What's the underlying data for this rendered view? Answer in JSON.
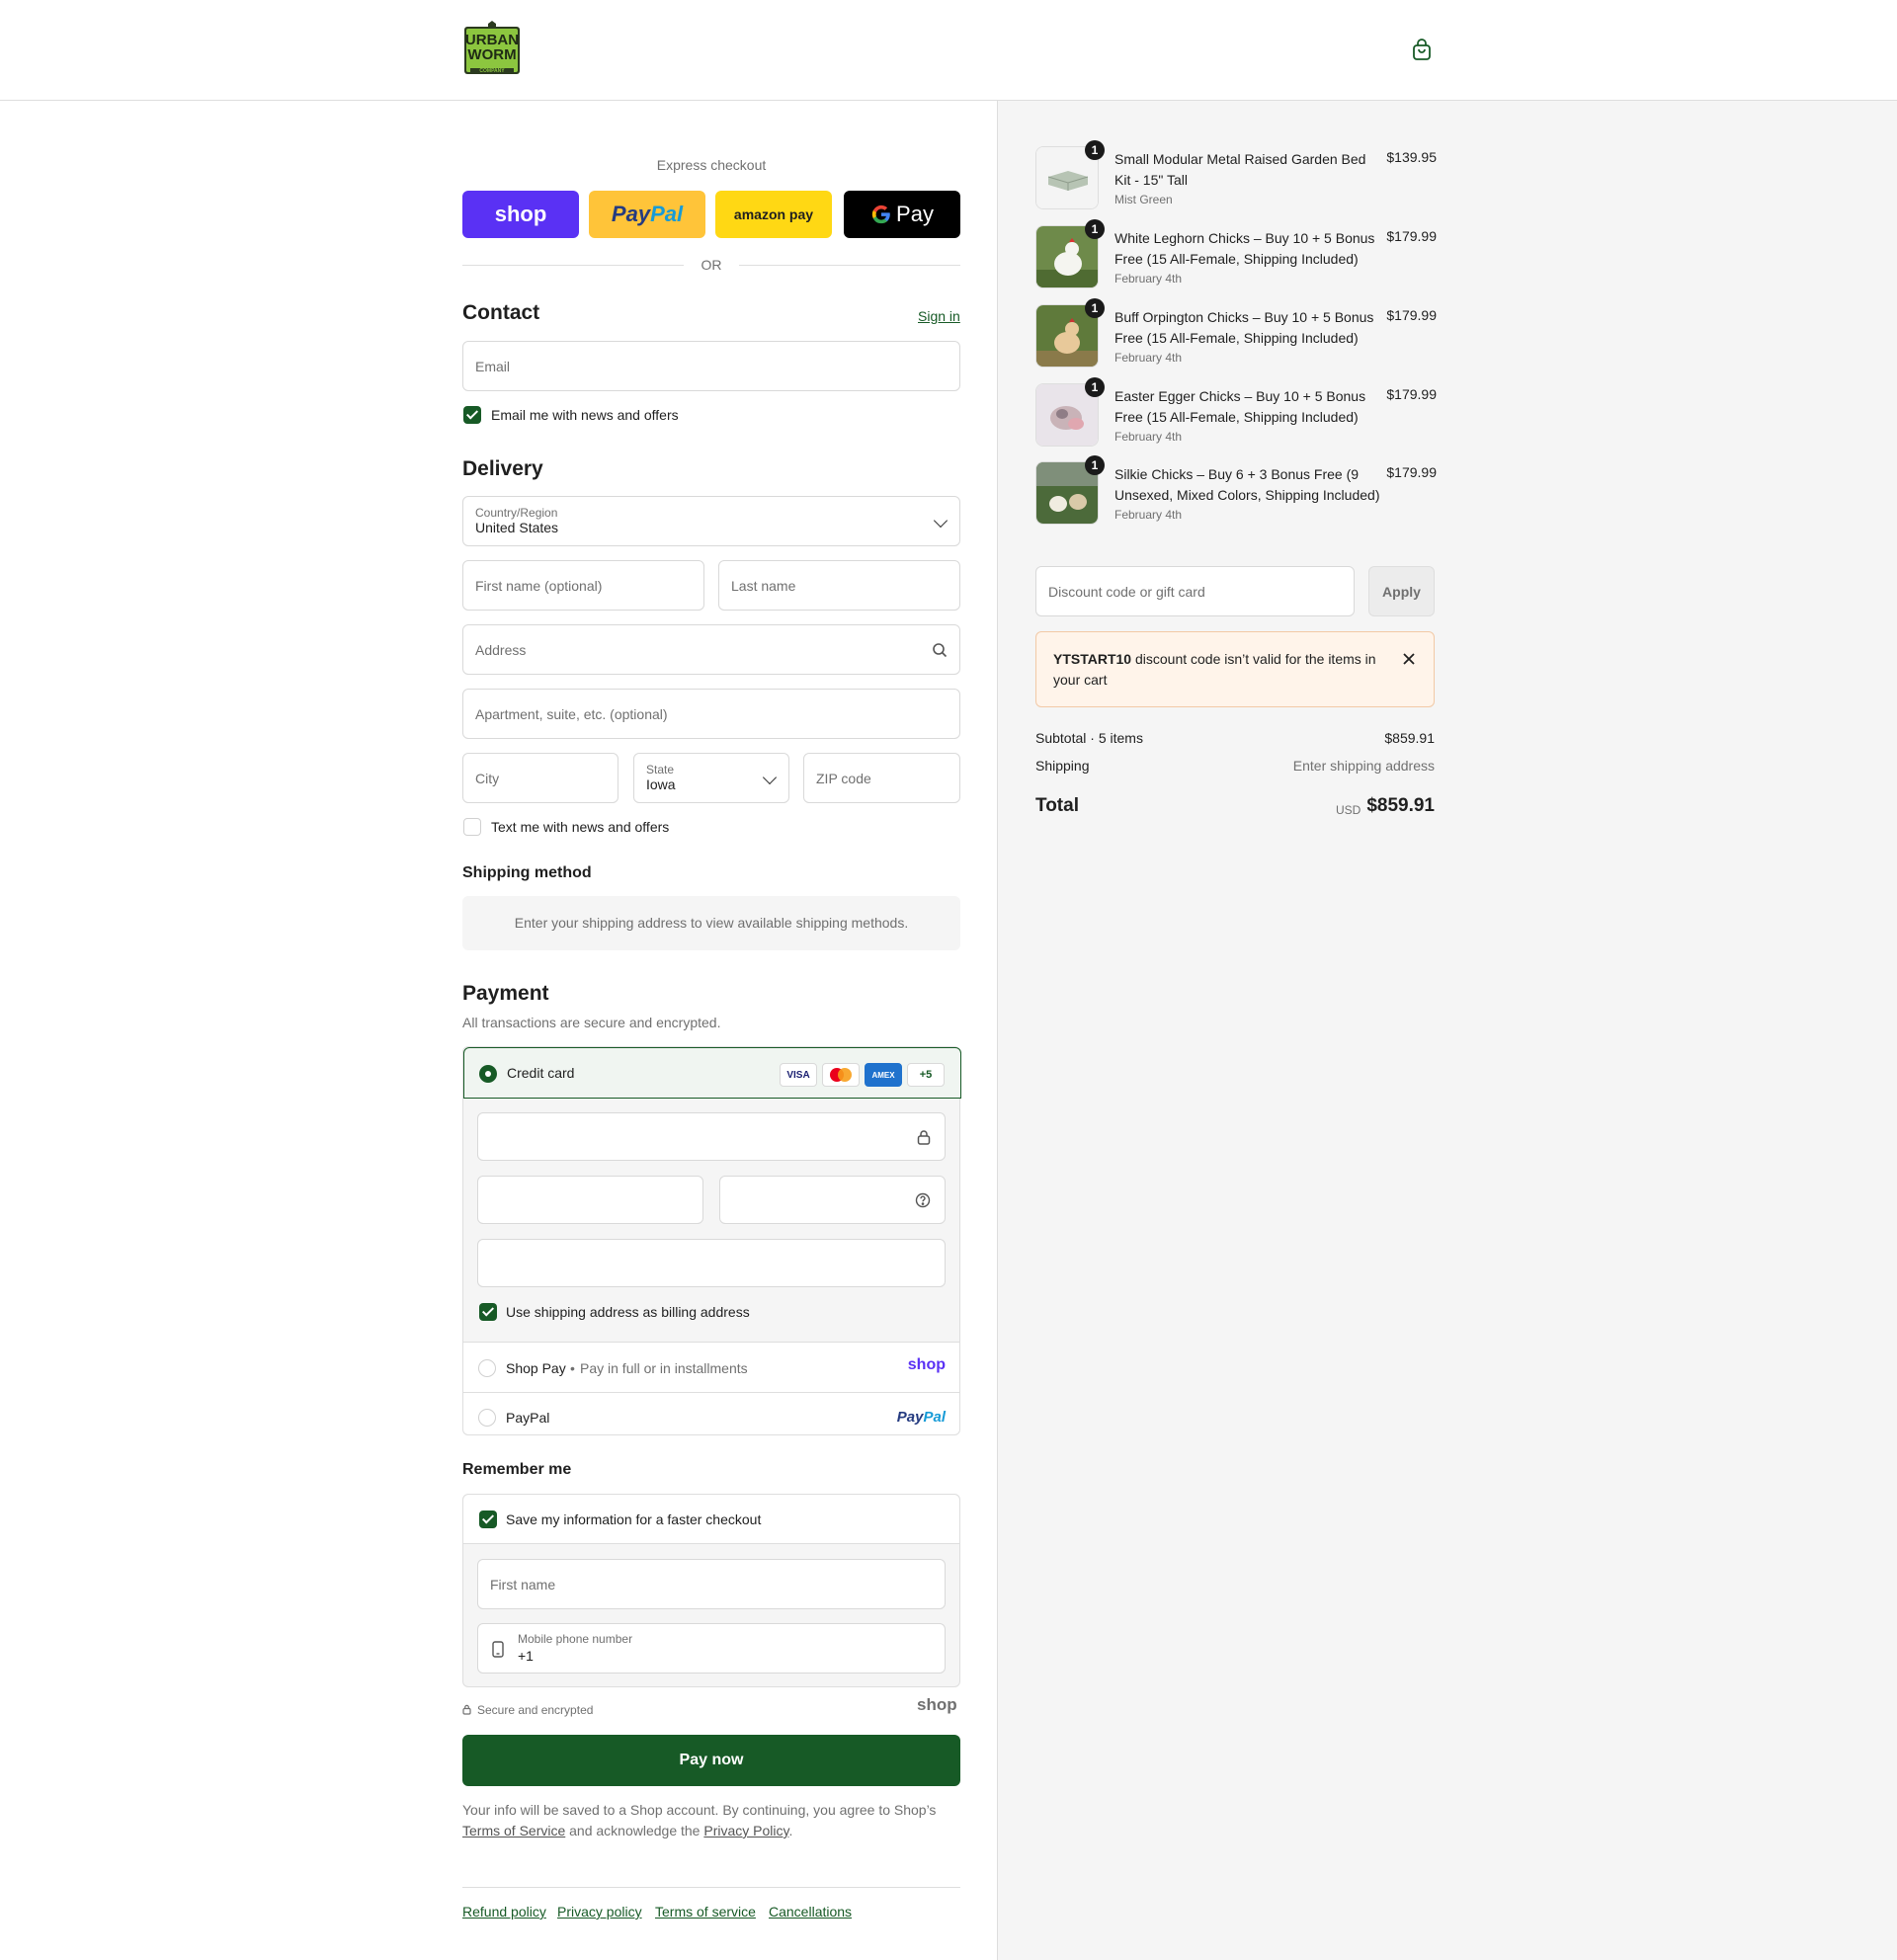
{
  "brand": {
    "logo_line1": "URBAN",
    "logo_line2": "WORM",
    "logo_line3": "COMPANY"
  },
  "express": {
    "label": "Express checkout",
    "shop": "shop",
    "paypal_a": "Pay",
    "paypal_b": "Pal",
    "amazon": "amazon pay",
    "gpay": "Pay",
    "or": "OR"
  },
  "contact": {
    "title": "Contact",
    "sign_in": "Sign in",
    "email_placeholder": "Email",
    "news_label": "Email me with news and offers"
  },
  "delivery": {
    "title": "Delivery",
    "country_label": "Country/Region",
    "country_value": "United States",
    "first_name": "First name (optional)",
    "last_name": "Last name",
    "address": "Address",
    "apartment": "Apartment, suite, etc. (optional)",
    "city": "City",
    "state_label": "State",
    "state_value": "Iowa",
    "zip": "ZIP code",
    "text_label": "Text me with news and offers"
  },
  "shipping": {
    "title": "Shipping method",
    "message": "Enter your shipping address to view available shipping methods."
  },
  "payment": {
    "title": "Payment",
    "subtitle": "All transactions are secure and encrypted.",
    "credit_card": "Credit card",
    "visa": "VISA",
    "amex": "AMEX",
    "more": "+5",
    "billing_label": "Use shipping address as billing address",
    "shop_pay": "Shop Pay",
    "shop_pay_sub": "Pay in full or in installments",
    "shop_logo": "shop",
    "paypal": "PayPal",
    "paypal_logo_a": "Pay",
    "paypal_logo_b": "Pal"
  },
  "remember": {
    "title": "Remember me",
    "save_label": "Save my information for a faster checkout",
    "first_name": "First name",
    "phone_label": "Mobile phone number",
    "phone_value": "+1",
    "secure": "Secure and encrypted",
    "shop_logo": "shop"
  },
  "pay_now": "Pay now",
  "legal": {
    "text1": "Your info will be saved to a Shop account. By continuing, you agree to Shop’s",
    "terms": "Terms of Service",
    "text2": "and acknowledge the",
    "privacy": "Privacy Policy",
    "end": "."
  },
  "footer": [
    "Refund policy",
    "Privacy policy",
    "Terms of service",
    "Cancellations"
  ],
  "cart": {
    "items": [
      {
        "qty": "1",
        "name": "Small Modular Metal Raised Garden Bed Kit - 15\" Tall",
        "sub": "Mist Green",
        "price": "$139.95"
      },
      {
        "qty": "1",
        "name": "White Leghorn Chicks – Buy 10 + 5 Bonus Free (15 All-Female, Shipping Included)",
        "sub": "February 4th",
        "price": "$179.99"
      },
      {
        "qty": "1",
        "name": "Buff Orpington Chicks – Buy 10 + 5 Bonus Free (15 All-Female, Shipping Included)",
        "sub": "February 4th",
        "price": "$179.99"
      },
      {
        "qty": "1",
        "name": "Easter Egger Chicks – Buy 10 + 5 Bonus Free (15 All-Female, Shipping Included)",
        "sub": "February 4th",
        "price": "$179.99"
      },
      {
        "qty": "1",
        "name": "Silkie Chicks – Buy 6 + 3 Bonus Free (9 Unsexed, Mixed Colors, Shipping Included)",
        "sub": "February 4th",
        "price": "$179.99"
      }
    ],
    "discount_placeholder": "Discount code or gift card",
    "apply": "Apply",
    "error_code": "YTSTART10",
    "error_text": "discount code isn’t valid for the items in your cart",
    "subtotal_label": "Subtotal · 5 items",
    "subtotal_value": "$859.91",
    "shipping_label": "Shipping",
    "shipping_value": "Enter shipping address",
    "total_label": "Total",
    "currency": "USD",
    "total_value": "$859.91"
  },
  "colors": {
    "accent": "#175a26",
    "shop_purple": "#5a31f4",
    "paypal_yellow": "#ffc439",
    "amazon_yellow": "#ffd814"
  }
}
